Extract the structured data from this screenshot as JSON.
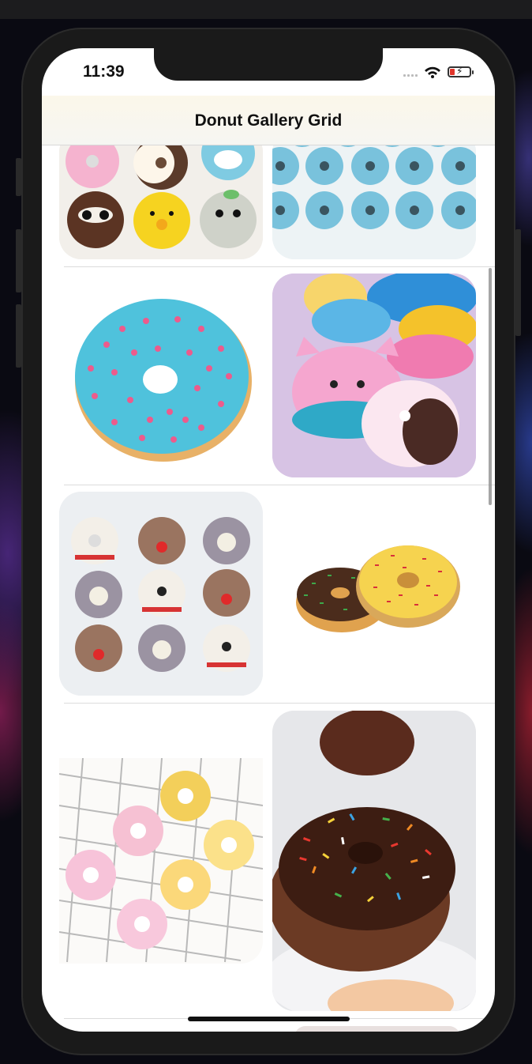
{
  "status_bar": {
    "time": "11:39"
  },
  "navbar": {
    "title": "Donut Gallery Grid"
  },
  "gallery": {
    "images": [
      {
        "subject": "animal-face-donuts"
      },
      {
        "subject": "blue-sprinkle-donuts"
      },
      {
        "subject": "blue-frosted-donut-pink-sprinkles"
      },
      {
        "subject": "squishy-cat-donut-toys"
      },
      {
        "subject": "christmas-character-donuts"
      },
      {
        "subject": "two-sprinkle-donuts"
      },
      {
        "subject": "rainbow-donuts-on-cooling-rack"
      },
      {
        "subject": "chocolate-donut-rainbow-sprinkles"
      }
    ]
  },
  "colors": {
    "navbar_bg": "#f8f6ee",
    "separator": "#dcdcdc",
    "battery_low": "#e0352b"
  },
  "icons": [
    "wifi-icon",
    "battery-charging-icon",
    "signal-icon"
  ]
}
